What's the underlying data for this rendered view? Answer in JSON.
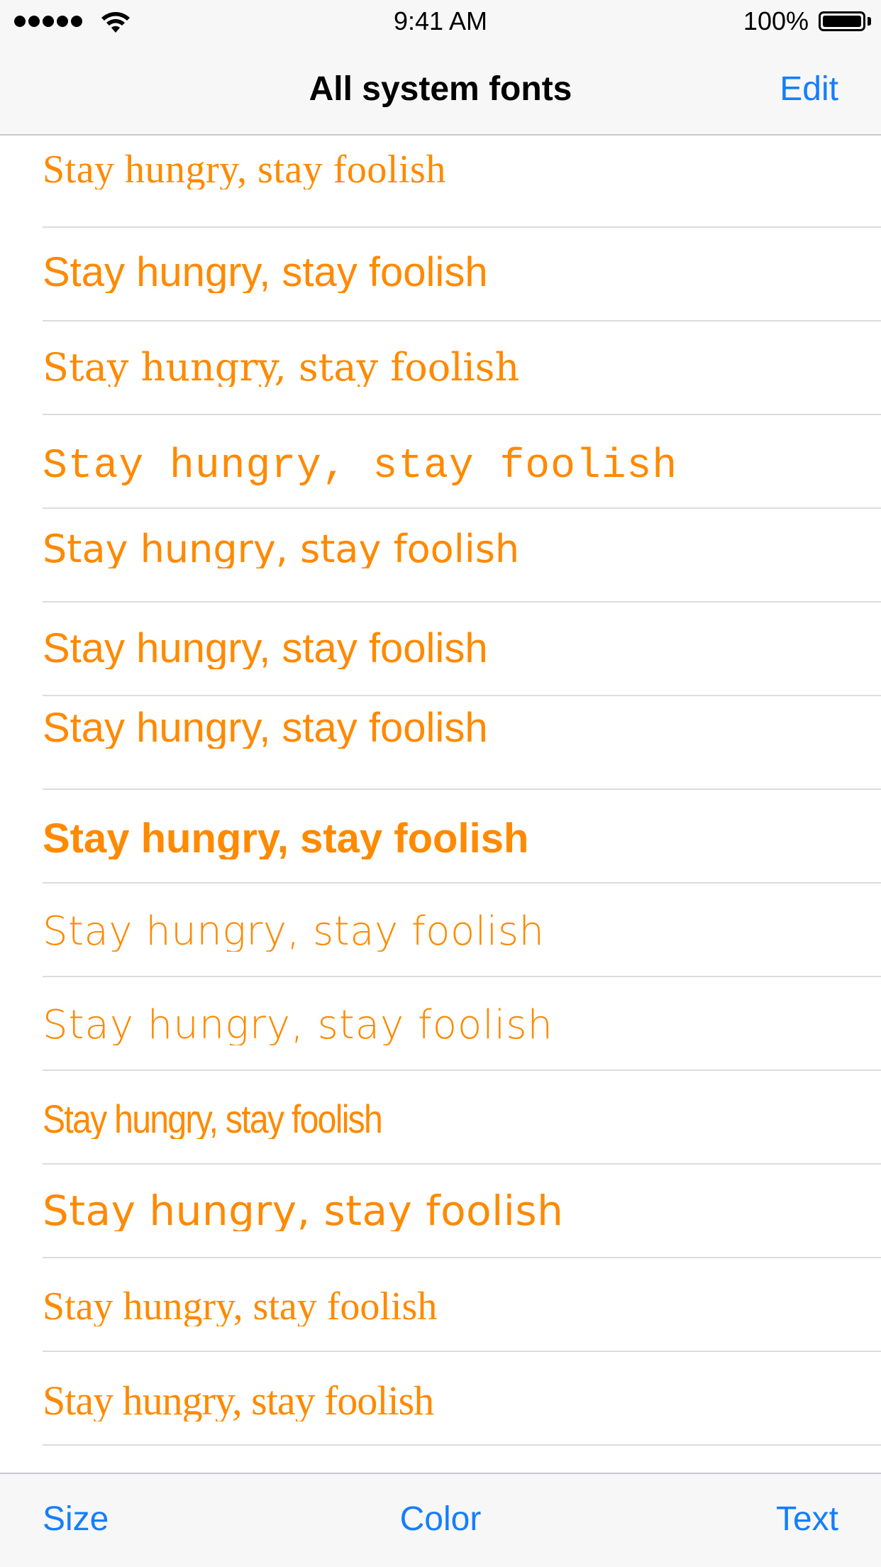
{
  "status_bar": {
    "time": "9:41 AM",
    "battery_percent": "100%",
    "signal_bars": 5,
    "battery_level": 1.0,
    "icons": [
      "signal-dots-icon",
      "wifi-icon",
      "battery-icon"
    ]
  },
  "nav_bar": {
    "title": "All system fonts",
    "edit_label": "Edit"
  },
  "font_list": {
    "sample_color": "#ff8a00",
    "items": [
      {
        "text": "Stay hungry, stay foolish"
      },
      {
        "text": "Stay hungry, stay foolish"
      },
      {
        "text": "Stay hungry, stay foolish"
      },
      {
        "text": "Stay hungry, stay foolish"
      },
      {
        "text": "Stay hungry, stay foolish"
      },
      {
        "text": "Stay hungry, stay foolish"
      },
      {
        "text": "Stay hungry, stay foolish"
      },
      {
        "text": "Stay hungry, stay foolish"
      },
      {
        "text": "Stay hungry, stay foolish"
      },
      {
        "text": "Stay hungry, stay foolish"
      },
      {
        "text": "Stay hungry, stay foolish"
      },
      {
        "text": "Stay hungry, stay foolish"
      },
      {
        "text": "Stay hungry, stay foolish"
      },
      {
        "text": "Stay hungry, stay foolish"
      }
    ]
  },
  "toolbar": {
    "size_label": "Size",
    "color_label": "Color",
    "text_label": "Text"
  },
  "colors": {
    "accent": "#157efb",
    "sample": "#ff8a00",
    "bar_background": "#f7f7f7",
    "separator": "#dcdcdf"
  }
}
